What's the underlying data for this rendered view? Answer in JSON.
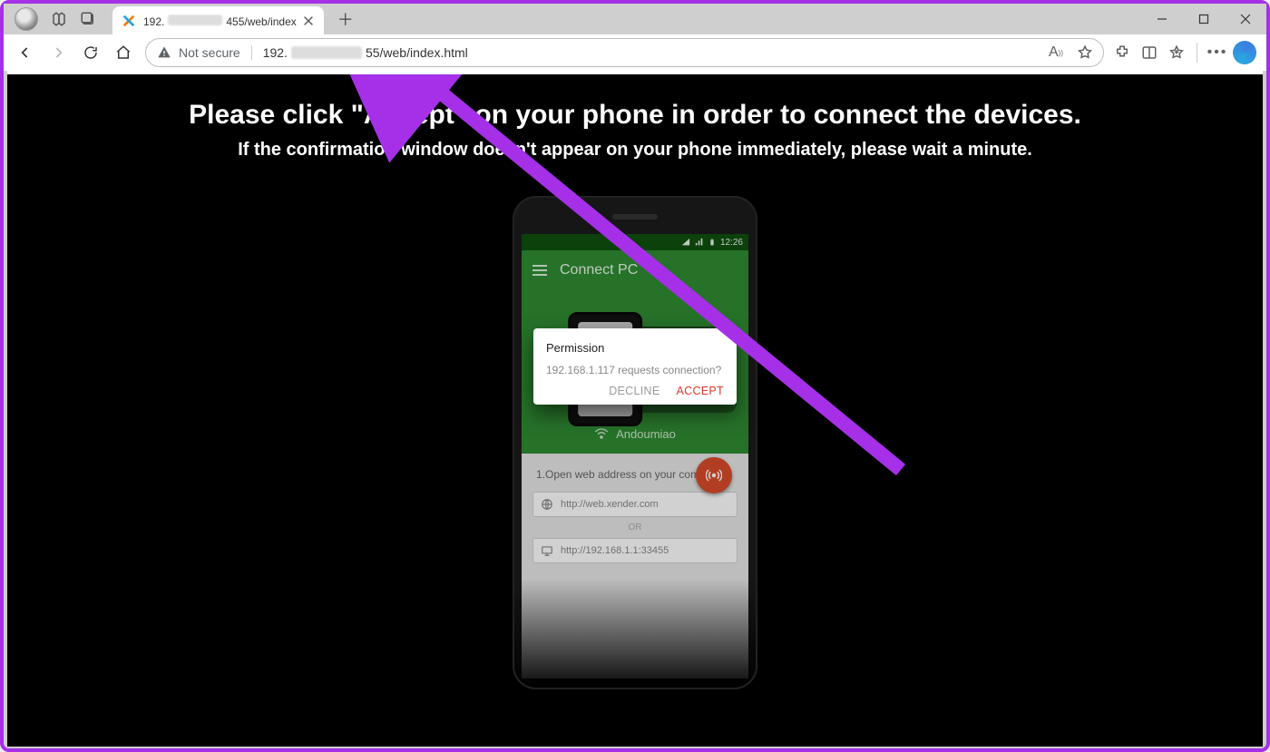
{
  "browser": {
    "tab": {
      "title_prefix": "192.",
      "title_suffix": "455/web/index"
    },
    "not_secure": "Not secure",
    "url_prefix": "192.",
    "url_suffix": "55/web/index.html"
  },
  "page": {
    "headline": "Please click \"Accept\" on your phone in order to connect the devices.",
    "subline": "If the confirmation window doesn't appear on your phone immediately, please wait a minute."
  },
  "phone": {
    "status_time": "12:26",
    "header_title": "Connect PC",
    "wifi_name": "Andoumiao",
    "step1": "1.Open web address on your computer",
    "url1": "http://web.xender.com",
    "or": "OR",
    "url2": "http://192.168.1.1:33455"
  },
  "dialog": {
    "title": "Permission",
    "body": "192.168.1.117 requests connection?",
    "decline": "DECLINE",
    "accept": "ACCEPT"
  }
}
